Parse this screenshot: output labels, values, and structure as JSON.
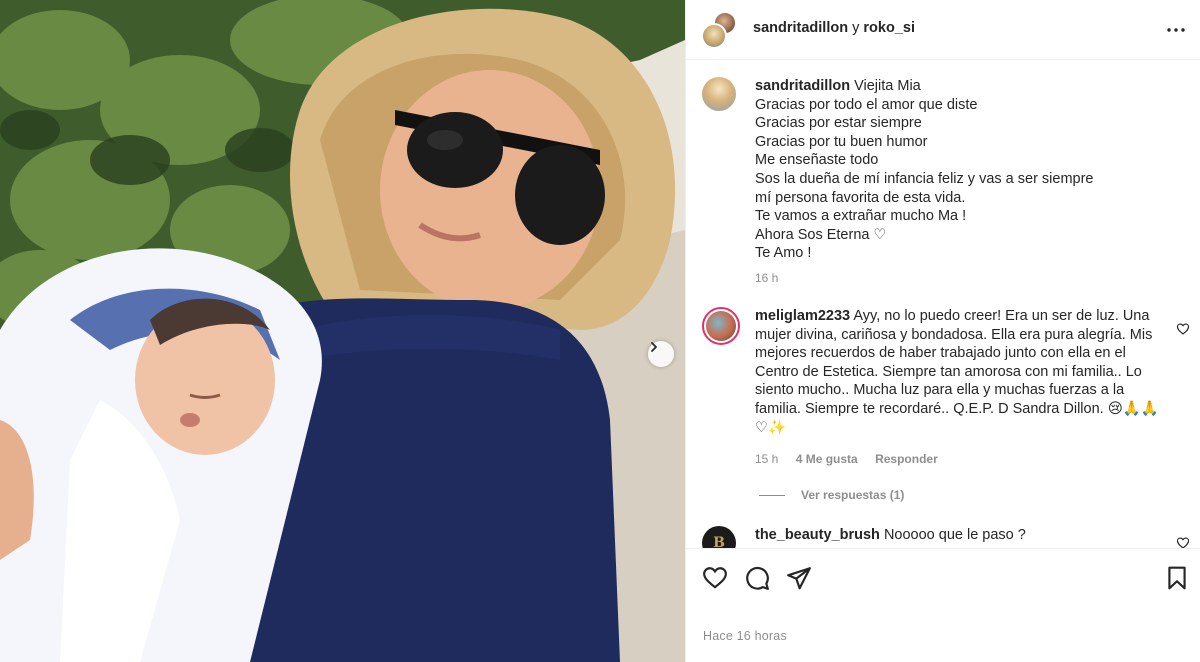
{
  "post_header": {
    "username_primary": "sandritadillon",
    "joiner": " y ",
    "username_secondary": "roko_si",
    "more_icon": "more-horizontal-icon"
  },
  "caption": {
    "username": "sandritadillon",
    "lines": [
      "Viejita Mia",
      "Gracias por todo el amor que diste",
      "Gracias por estar siempre",
      "Gracias por tu buen humor",
      "Me enseñaste todo",
      "Sos la dueña de mí infancia feliz y vas a ser siempre",
      "mí persona favorita de esta vida.",
      "Te vamos a extrañar mucho Ma !",
      "Ahora Sos Eterna ♡",
      "Te Amo !"
    ],
    "time": "16 h"
  },
  "comments": [
    {
      "username": "meliglam2233",
      "lines": [
        "Ayy, no lo puedo creer! Era un ser de luz. Una",
        "mujer divina, cariñosa y bondadosa. Ella era pura alegría. Mis",
        "mejores recuerdos de haber trabajado junto con ella en el",
        "Centro de Estetica. Siempre tan amorosa con mi familia.. Lo",
        "siento mucho.. Mucha luz para ella y muchas fuerzas a la",
        "familia. Siempre te recordaré.. Q.E.P. D Sandra Dillon. 😢🙏🙏",
        "♡✨"
      ],
      "time": "15 h",
      "likes": "4 Me gusta",
      "reply": "Responder",
      "view_replies": "Ver respuestas (1)"
    },
    {
      "username": "the_beauty_brush",
      "text": "Nooooo que le paso ?",
      "avatar_letter": "B"
    }
  ],
  "actions": {
    "like_icon": "heart-icon",
    "comment_icon": "comment-icon",
    "share_icon": "send-icon",
    "save_icon": "bookmark-icon"
  },
  "timestamp": "Hace 16 horas",
  "colors": {
    "text": "#262626",
    "muted": "#8e8e8e",
    "border": "#efefef",
    "story_ring": "#e1306c"
  }
}
